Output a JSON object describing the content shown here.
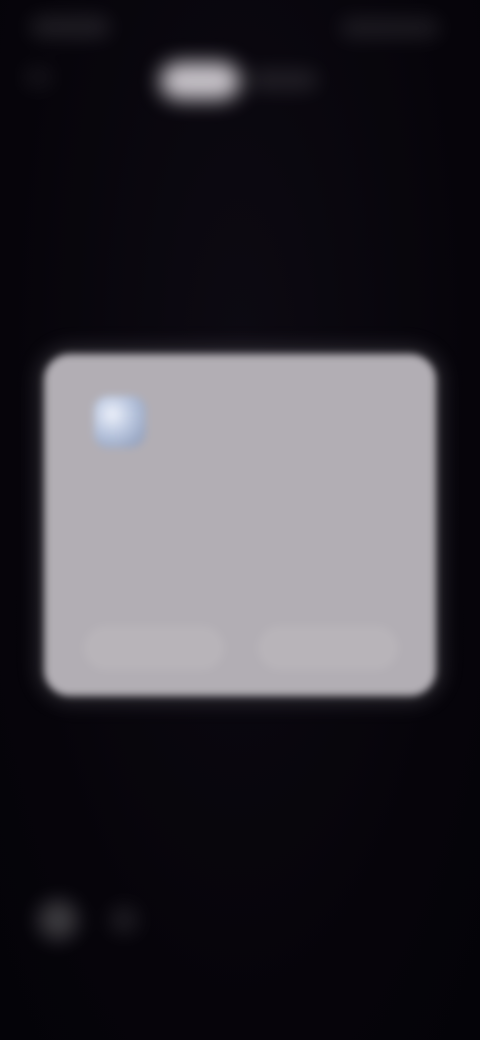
{
  "dialog": {
    "title": "",
    "body": "",
    "secondary_button": "",
    "primary_button": ""
  },
  "colors": {
    "background": "#07050a",
    "dialog_background": "#b2aeb4",
    "app_icon_accent": "#bcc8e0"
  },
  "icons": {
    "app_icon": "app-logo-icon",
    "back": "back-arrow-icon",
    "home_primary": "circle-icon",
    "home_secondary": "circle-icon"
  }
}
